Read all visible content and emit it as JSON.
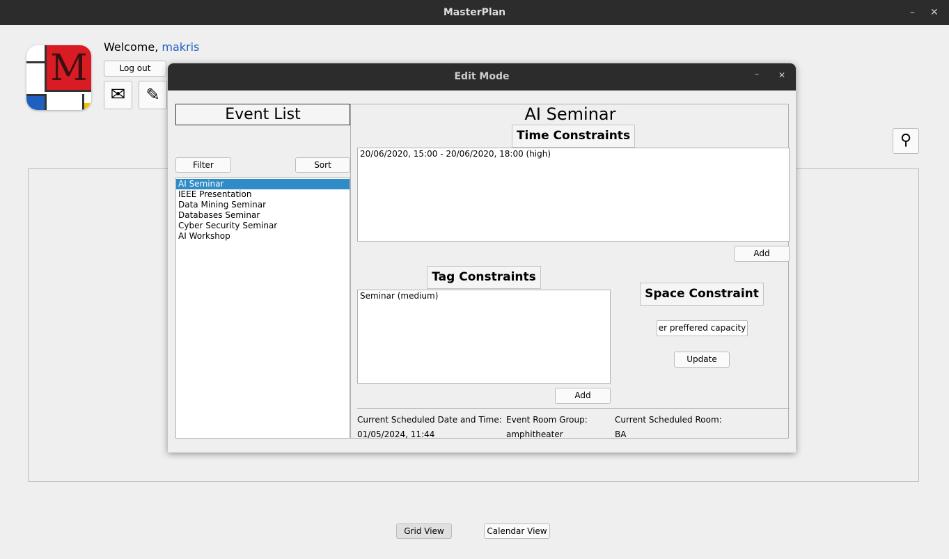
{
  "app": {
    "title": "MasterPlan",
    "welcome": "Welcome,",
    "username": "makris",
    "logout": "Log out",
    "logo_letter": "M"
  },
  "footer": {
    "grid_view": "Grid View",
    "calendar_view": "Calendar View"
  },
  "dialog": {
    "title": "Edit Mode",
    "event_list": {
      "title": "Event List",
      "filter": "Filter",
      "sort": "Sort",
      "items": [
        "AI Seminar",
        "IEEE Presentation",
        "Data Mining Seminar",
        "Databases Seminar",
        "Cyber Security Seminar",
        "AI Workshop"
      ],
      "selected": "AI Seminar"
    },
    "event_title": "AI Seminar",
    "time": {
      "title": "Time Constraints",
      "items": [
        "20/06/2020, 15:00 - 20/06/2020, 18:00 (high)"
      ],
      "add": "Add"
    },
    "tag": {
      "title": "Tag Constraints",
      "items": [
        "Seminar (medium)"
      ],
      "add": "Add"
    },
    "space": {
      "title": "Space Constraint",
      "input_value": "er preffered capacity",
      "update": "Update"
    },
    "info": {
      "date_label": "Current Scheduled Date and Time:",
      "date_value": "01/05/2024, 11:44",
      "group_label": "Event Room Group:",
      "group_value": "amphitheater",
      "room_label": "Current Scheduled Room:",
      "room_value": "BA"
    }
  }
}
